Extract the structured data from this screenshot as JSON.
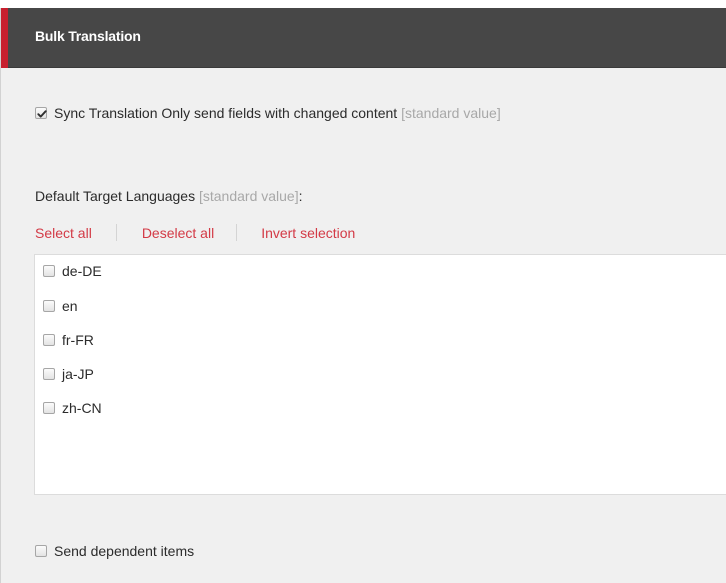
{
  "header": {
    "title": "Bulk Translation",
    "accent_color": "#c7202f",
    "background_color": "#474747"
  },
  "sync": {
    "checked": true,
    "label": "Sync Translation Only send fields with changed content",
    "standard_value": "[standard value]"
  },
  "default_languages": {
    "label": "Default Target Languages",
    "standard_value": "[standard value]",
    "suffix": ":"
  },
  "selection_links": {
    "select_all": "Select all",
    "deselect_all": "Deselect all",
    "invert_selection": "Invert selection",
    "link_color": "#d33a46"
  },
  "languages": [
    {
      "code": "de-DE",
      "checked": false
    },
    {
      "code": "en",
      "checked": false
    },
    {
      "code": "fr-FR",
      "checked": false
    },
    {
      "code": "ja-JP",
      "checked": false
    },
    {
      "code": "zh-CN",
      "checked": false
    }
  ],
  "dependent": {
    "checked": false,
    "label": "Send dependent items"
  }
}
